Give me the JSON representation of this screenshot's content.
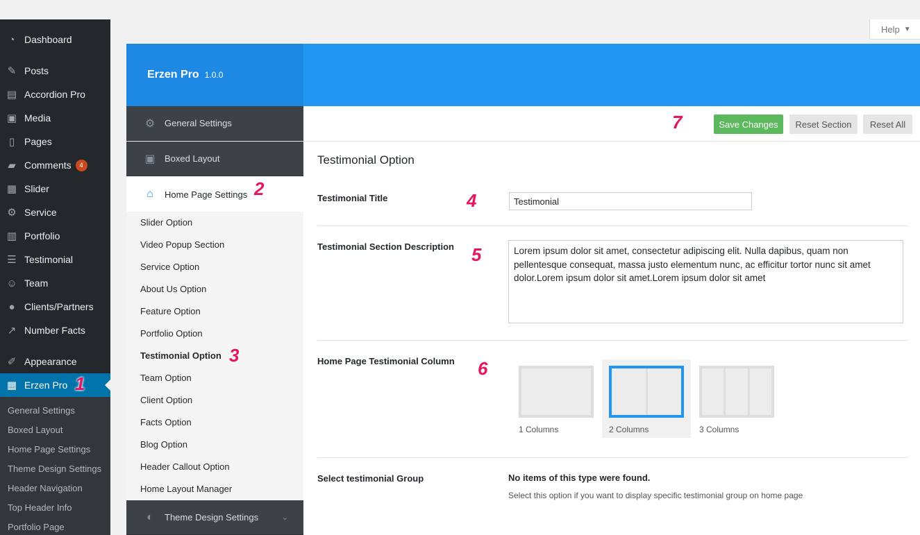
{
  "wp_menu": [
    {
      "label": "Dashboard",
      "icon": "dashboard-icon"
    },
    {
      "label": "Posts",
      "icon": "pin-icon"
    },
    {
      "label": "Accordion Pro",
      "icon": "accordion-icon"
    },
    {
      "label": "Media",
      "icon": "media-icon"
    },
    {
      "label": "Pages",
      "icon": "pages-icon"
    },
    {
      "label": "Comments",
      "icon": "comment-icon",
      "badge": "4"
    },
    {
      "label": "Slider",
      "icon": "slider-icon"
    },
    {
      "label": "Service",
      "icon": "gear-icon"
    },
    {
      "label": "Portfolio",
      "icon": "portfolio-icon"
    },
    {
      "label": "Testimonial",
      "icon": "list-icon"
    },
    {
      "label": "Team",
      "icon": "team-icon"
    },
    {
      "label": "Clients/Partners",
      "icon": "user-icon"
    },
    {
      "label": "Number Facts",
      "icon": "chart-line-icon"
    },
    {
      "label": "Appearance",
      "icon": "brush-icon"
    },
    {
      "label": "Erzen Pro",
      "icon": "table-icon",
      "current": true
    }
  ],
  "wp_submenu": [
    "General Settings",
    "Boxed Layout",
    "Home Page Settings",
    "Theme Design Settings",
    "Header Navigation",
    "Top Header Info",
    "Portfolio Page"
  ],
  "help": {
    "label": "Help"
  },
  "brand": {
    "name": "Erzen Pro",
    "version": "1.0.0"
  },
  "panel_nav": {
    "general": "General Settings",
    "boxed": "Boxed Layout",
    "home": "Home Page Settings",
    "theme_design": "Theme Design Settings",
    "sub_items": [
      "Slider Option",
      "Video Popup Section",
      "Service Option",
      "About Us Option",
      "Feature Option",
      "Portfolio Option",
      "Testimonial Option",
      "Team Option",
      "Client Option",
      "Facts Option",
      "Blog Option",
      "Header Callout Option",
      "Home Layout Manager"
    ],
    "active_sub": "Testimonial Option"
  },
  "toolbar": {
    "save": "Save Changes",
    "reset_section": "Reset Section",
    "reset_all": "Reset All"
  },
  "section": {
    "title": "Testimonial Option",
    "testimonial_title_label": "Testimonial Title",
    "testimonial_title_value": "Testimonial",
    "description_label": "Testimonial Section Description",
    "description_value": "Lorem ipsum dolor sit amet, consectetur adipiscing elit. Nulla dapibus, quam non pellentesque consequat, massa justo elementum nunc, ac efficitur tortor nunc sit amet dolor.Lorem ipsum dolor sit amet.Lorem ipsum dolor sit amet",
    "column_label": "Home Page Testimonial Column",
    "columns": [
      "1 Columns",
      "2 Columns",
      "3 Columns"
    ],
    "selected_column": "2 Columns",
    "group_label": "Select testimonial Group",
    "group_empty": "No items of this type were found.",
    "group_desc": "Select this option if you want to display specific testimonial group on home page"
  },
  "steps": [
    "1",
    "2",
    "3",
    "4",
    "5",
    "6",
    "7"
  ],
  "colors": {
    "accent": "#2196f3",
    "save": "#5cb85c",
    "step": "#e5155f",
    "wp_current": "#0073aa"
  }
}
